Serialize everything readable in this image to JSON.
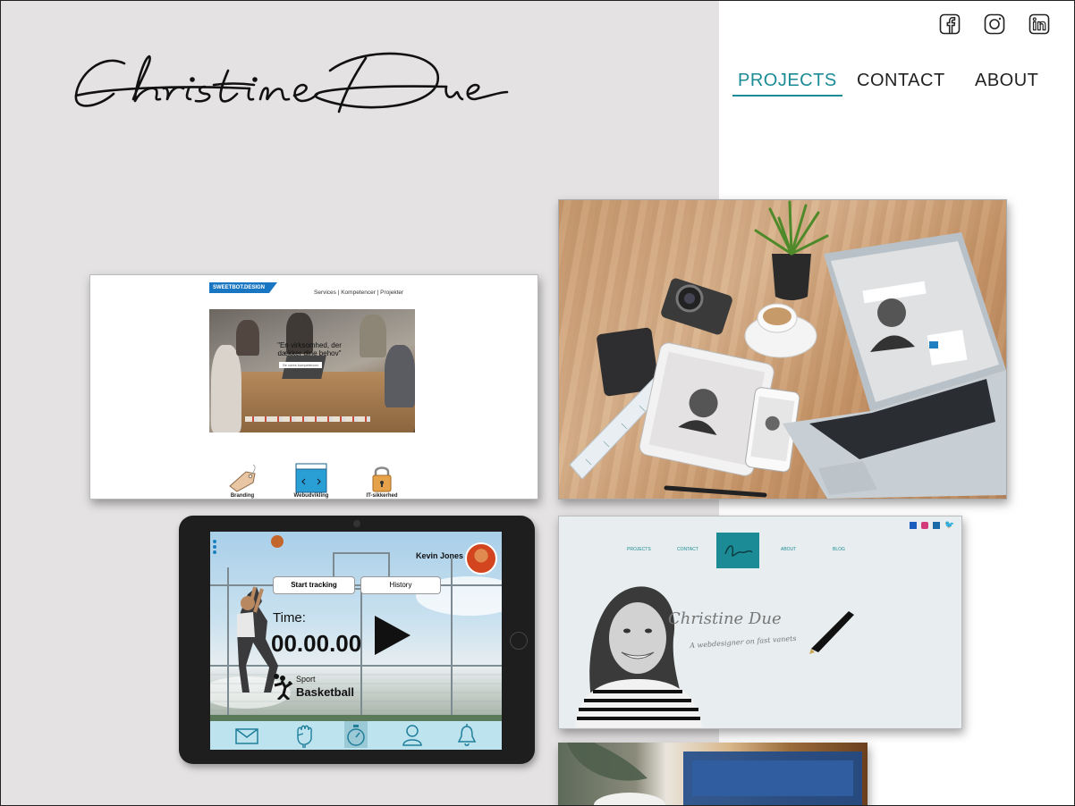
{
  "logo_text": "Christine Due",
  "social": [
    {
      "name": "facebook-icon"
    },
    {
      "name": "instagram-icon"
    },
    {
      "name": "linkedin-icon"
    }
  ],
  "nav": {
    "projects": "PROJECTS",
    "contact": "CONTACT",
    "about": "ABOUT",
    "active": "projects"
  },
  "colors": {
    "accent": "#1b8b95",
    "panel": "#e4e2e3",
    "sweetbot_blue": "#1976c2"
  },
  "sweetbot": {
    "brand": "SWEETBOT.DESIGN",
    "nav": "Services  |  Kompetencer  |  Projekter",
    "quote_line1": "\"En virksomhed, der",
    "quote_line2": "dækker dine behov\"",
    "quote_button": "Se vores kompetencer",
    "icons": [
      {
        "label": "Branding",
        "icon": "tag-icon"
      },
      {
        "label": "Webudvikling",
        "icon": "browser-icon"
      },
      {
        "label": "IT-sikkerhed",
        "icon": "lock-icon"
      }
    ]
  },
  "tablet": {
    "user": "Kevin Jones",
    "start_tracking": "Start tracking",
    "history": "History",
    "time_label": "Time:",
    "time_value": "00.00.00",
    "sport_label": "Sport",
    "sport_value": "Basketball",
    "tabbar": [
      "mail-icon",
      "fist-icon",
      "stopwatch-icon",
      "profile-icon",
      "bell-icon"
    ]
  },
  "portfolio": {
    "nav": [
      "PROJECTS",
      "CONTACT",
      "ABOUT",
      "BLOG"
    ],
    "logo": "Christine Due",
    "tagline": "A webdesigner on fast vanets"
  }
}
